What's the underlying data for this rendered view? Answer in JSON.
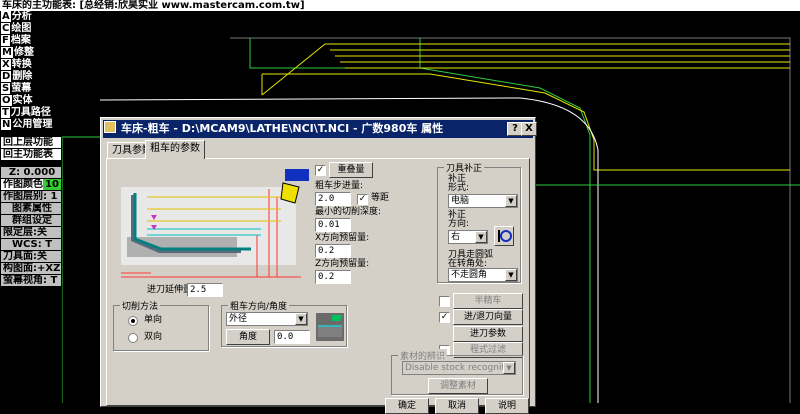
{
  "topbar": {
    "title": "车床的主功能表: [总经销:欣昊实业 www.mastercam.com.tw]"
  },
  "menu": {
    "items": [
      {
        "key": "A",
        "label": "分析"
      },
      {
        "key": "C",
        "label": "绘图"
      },
      {
        "key": "F",
        "label": "档案"
      },
      {
        "key": "M",
        "label": "修整"
      },
      {
        "key": "X",
        "label": "转换"
      },
      {
        "key": "D",
        "label": "删除"
      },
      {
        "key": "S",
        "label": "萤幕"
      },
      {
        "key": "O",
        "label": "实体"
      },
      {
        "key": "T",
        "label": "刀具路径"
      },
      {
        "key": "N",
        "label": "公用管理"
      }
    ],
    "back_upper": "回上层功能",
    "back_main": "回主功能表"
  },
  "status": {
    "z_label": "Z:",
    "z_value": "0.000",
    "color_label": "作图颜色",
    "color_value": "10",
    "layer_label": "作图层别:",
    "layer_value": "1",
    "entity_attr": "图素属性",
    "group_setting": "群组设定",
    "limit_layer": "限定层:关",
    "wcs_label": "WCS:",
    "wcs_value": "T",
    "tool_plane": "刀具面:关",
    "construct_plane": "构图面:+XZ",
    "screen_view_label": "萤幕视角:",
    "screen_view_value": "T"
  },
  "dialog": {
    "title": "车床-粗车 - D:\\MCAM9\\LATHE\\NCI\\T.NCI - 广数980车 属性",
    "help_btn": "?",
    "close_btn": "X",
    "tabs": [
      "刀具参数",
      "粗车的参数"
    ],
    "overlap_btn": "重叠量",
    "step_label": "粗车步进量:",
    "step_value": "2.0",
    "equal_label": "等距",
    "min_cut_label": "最小的切削深度:",
    "min_cut_value": "0.01",
    "x_stock_label": "X方向预留量:",
    "x_stock_value": "0.2",
    "z_stock_label": "Z方向预留量:",
    "z_stock_value": "0.2",
    "entry_ext_label": "进刀延伸量:",
    "entry_ext_value": "2.5",
    "comp": {
      "group_title": "刀具补正",
      "form_label1": "补正",
      "form_label2": "形式:",
      "form_value": "电脑",
      "dir_label1": "补正",
      "dir_label2": "方向:",
      "dir_value": "右",
      "corner_label1": "刀具走圆弧",
      "corner_label2": "在转角处:",
      "corner_value": "不走圆角"
    },
    "semi_finish_btn": "半精车",
    "lead_btn": "进/退刀向量",
    "plunge_btn": "进刀参数",
    "filter_btn": "程式过滤",
    "cut_method": {
      "title": "切削方法",
      "one_way": "单向",
      "zigzag": "双向"
    },
    "rough_dir": {
      "title": "粗车方向/角度",
      "direction_value": "外径",
      "angle_btn": "角度",
      "angle_value": "0.0"
    },
    "stock_recog": {
      "title": "素材的辨识",
      "select_value": "Disable stock recognition",
      "adjust_btn": "调整素材"
    },
    "ok_btn": "确定",
    "cancel_btn": "取消",
    "help2_btn": "说明"
  }
}
